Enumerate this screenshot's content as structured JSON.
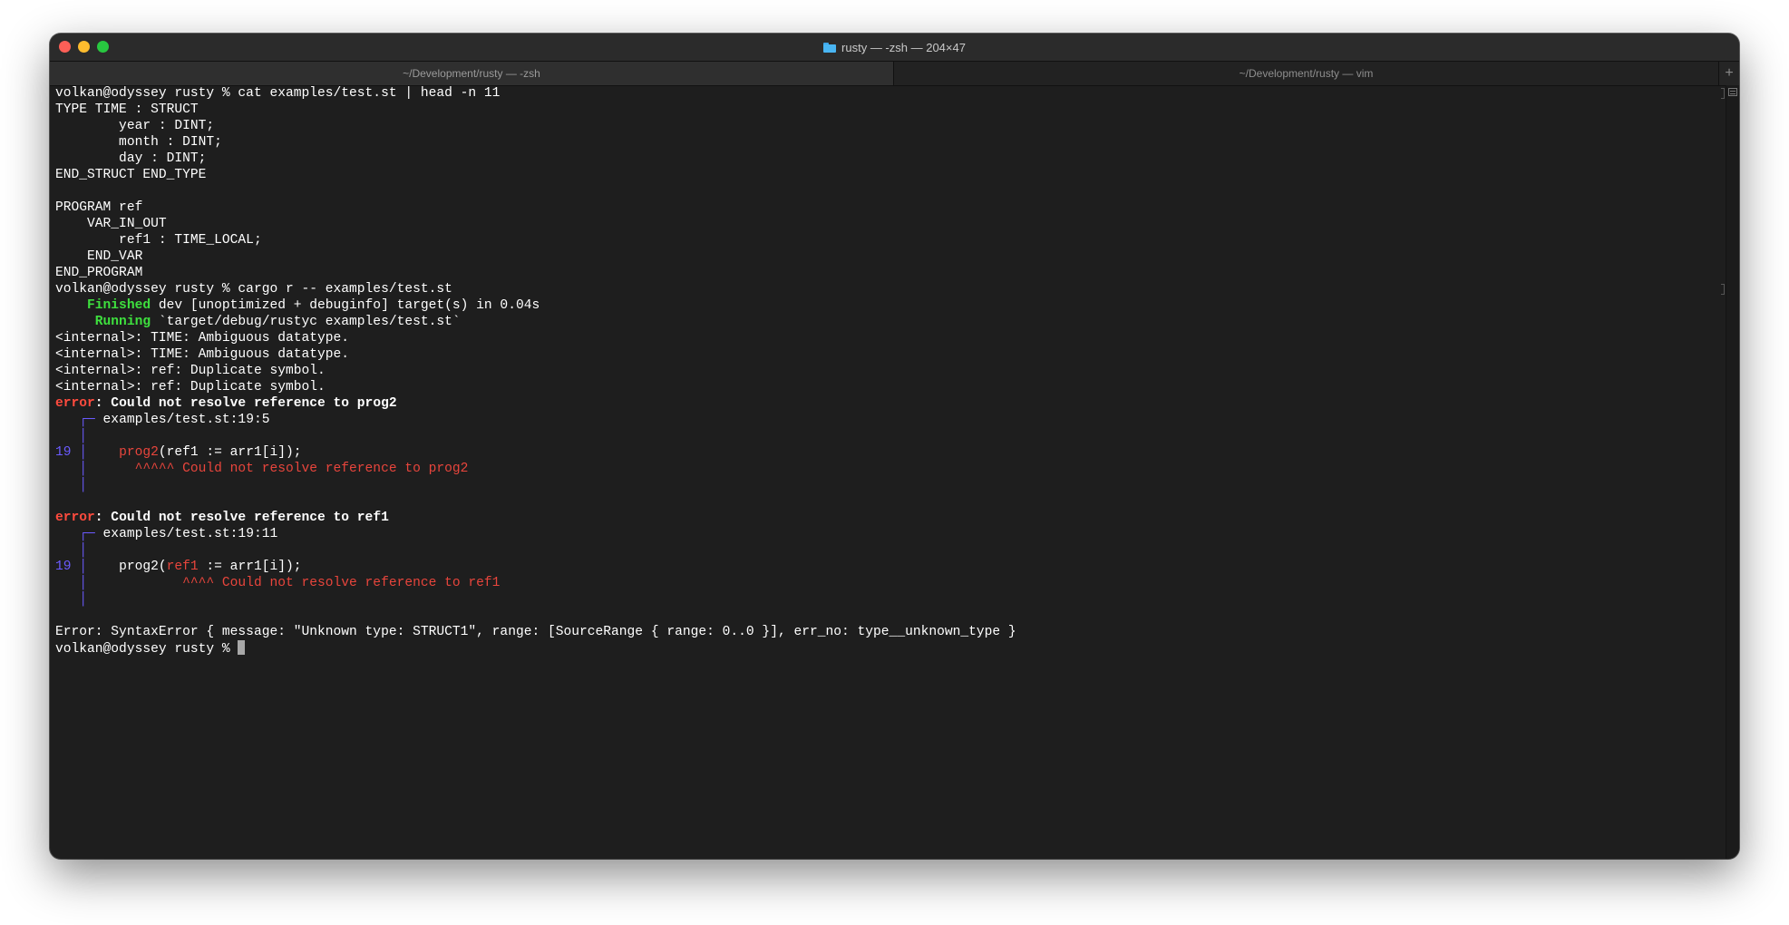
{
  "window": {
    "title": "rusty — -zsh — 204×47",
    "folder_icon": "folder-icon"
  },
  "tabs": [
    {
      "label": "~/Development/rusty — -zsh",
      "active": true
    },
    {
      "label": "~/Development/rusty — vim",
      "active": false
    }
  ],
  "new_tab_label": "+",
  "terminal": {
    "l1": "volkan@odyssey rusty % cat examples/test.st | head -n 11",
    "l2": "TYPE TIME : STRUCT",
    "l3": "        year : DINT;",
    "l4": "        month : DINT;",
    "l5": "        day : DINT;",
    "l6": "END_STRUCT END_TYPE",
    "l7": "",
    "l8": "PROGRAM ref",
    "l9": "    VAR_IN_OUT",
    "l10": "        ref1 : TIME_LOCAL;",
    "l11": "    END_VAR",
    "l12": "END_PROGRAM",
    "l13": "volkan@odyssey rusty % cargo r -- examples/test.st",
    "l14_kw": "    Finished",
    "l14_rest": " dev [unoptimized + debuginfo] target(s) in 0.04s",
    "l15_kw": "     Running",
    "l15_rest": " `target/debug/rustyc examples/test.st`",
    "l16": "<internal>: TIME: Ambiguous datatype.",
    "l17": "<internal>: TIME: Ambiguous datatype.",
    "l18": "<internal>: ref: Duplicate symbol.",
    "l19": "<internal>: ref: Duplicate symbol.",
    "e1_kw": "error",
    "e1_msg": ": Could not resolve reference to prog2",
    "e1_loc_gutter": "   ┌─",
    "e1_loc": " examples/test.st:19:5",
    "e1_blank_gutter": "   │",
    "e1_code_ln": "19",
    "e1_code_bar": " │ ",
    "e1_code_hl": "   prog2",
    "e1_code_rest": "(ref1 := arr1[i]);",
    "e1_under_gutter": "   │",
    "e1_under": "      ^^^^^ Could not resolve reference to prog2",
    "e1_end_gutter": "   │",
    "e2_kw": "error",
    "e2_msg": ": Could not resolve reference to ref1",
    "e2_loc_gutter": "   ┌─",
    "e2_loc": " examples/test.st:19:11",
    "e2_blank_gutter": "   │",
    "e2_code_ln": "19",
    "e2_code_bar": " │ ",
    "e2_code_pre": "   prog2(",
    "e2_code_hl": "ref1",
    "e2_code_rest": " := arr1[i]);",
    "e2_under_gutter": "   │",
    "e2_under": "            ^^^^ Could not resolve reference to ref1",
    "e2_end_gutter": "   │",
    "syntax_error": "Error: SyntaxError { message: \"Unknown type: STRUCT1\", range: [SourceRange { range: 0..0 }], err_no: type__unknown_type }",
    "prompt": "volkan@odyssey rusty % "
  }
}
